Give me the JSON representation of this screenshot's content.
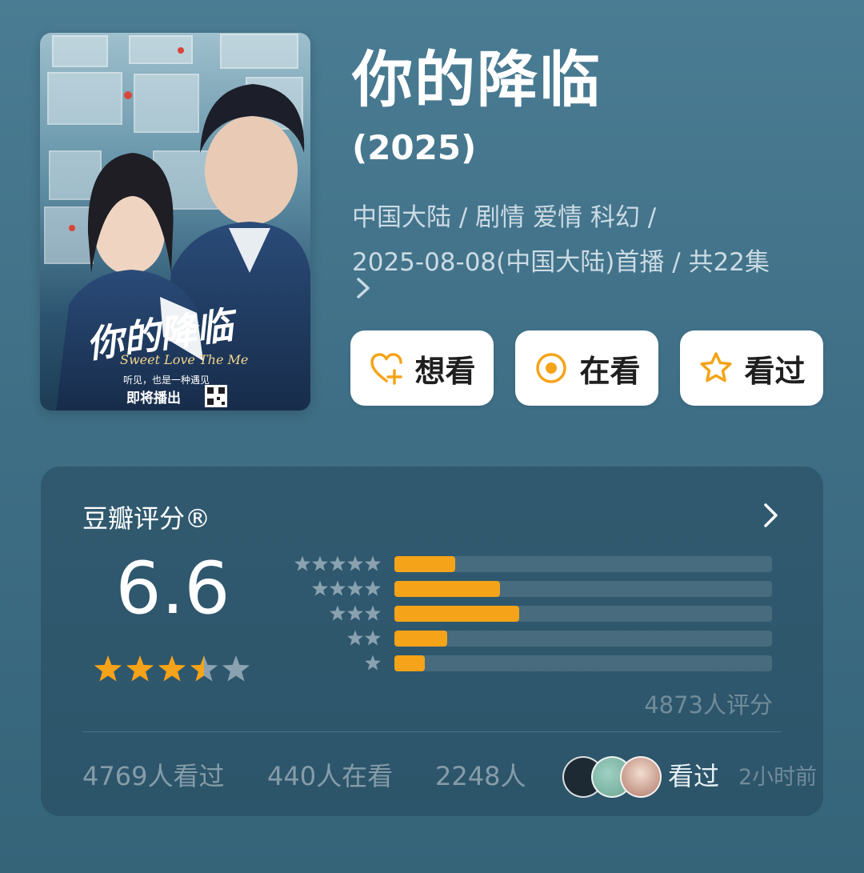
{
  "movie": {
    "title": "你的降临",
    "year": "(2025)",
    "meta_line1": "中国大陆 / 剧情 爱情 科幻 /",
    "meta_line2": "2025-08-08(中国大陆)首播 / 共22集",
    "poster": {
      "title_text": "你的降临",
      "script_text": "Sweet Love The Me",
      "tagline": "听见，也是一种遇见",
      "coming_text": "即将播出"
    }
  },
  "actions": [
    {
      "label": "想看",
      "icon": "heart-plus-icon"
    },
    {
      "label": "在看",
      "icon": "target-circle-icon"
    },
    {
      "label": "看过",
      "icon": "star-outline-icon"
    }
  ],
  "rating": {
    "title": "豆瓣评分®",
    "score": "6.6",
    "stars_value": 3.5,
    "stars_max": 5,
    "count_text": "4873人评分",
    "distribution": [
      {
        "stars": 5,
        "fraction": 0.16
      },
      {
        "stars": 4,
        "fraction": 0.28
      },
      {
        "stars": 3,
        "fraction": 0.33
      },
      {
        "stars": 2,
        "fraction": 0.14
      },
      {
        "stars": 1,
        "fraction": 0.08
      }
    ]
  },
  "stats": {
    "watched": "4769人看过",
    "watching": "440人在看",
    "want": "2248人",
    "friend_action": "看过",
    "friend_time": "2小时前"
  },
  "colors": {
    "accent": "#f5a318",
    "star_inactive": "#8aa2b0",
    "card_bg": "rgba(28,58,79,0.38)"
  }
}
